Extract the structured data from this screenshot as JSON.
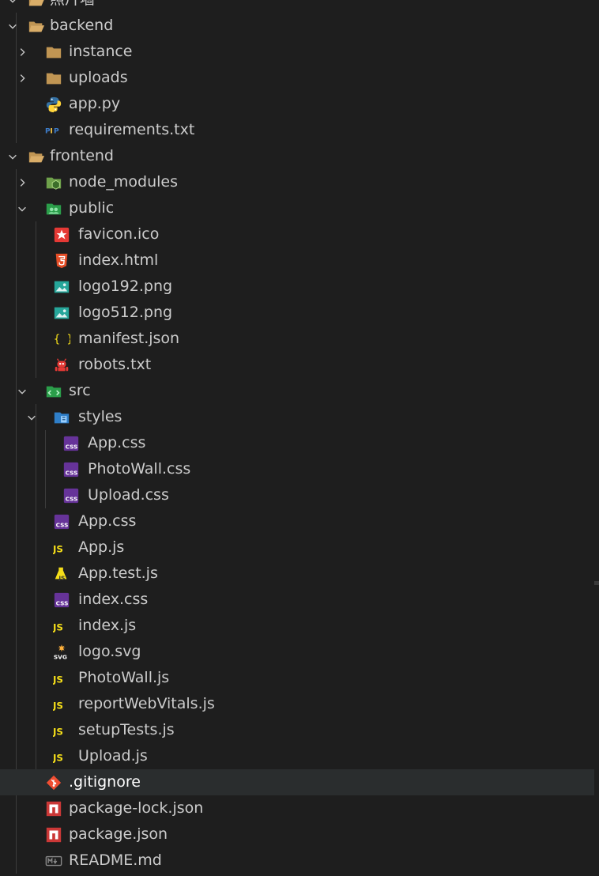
{
  "explorer": {
    "items": [
      {
        "label": "照片墙",
        "depth": 0,
        "kind": "folder",
        "expanded": true,
        "icon": "folder-open-icon"
      },
      {
        "label": "backend",
        "depth": 0,
        "kind": "folder",
        "expanded": true,
        "icon": "folder-open-icon"
      },
      {
        "label": "instance",
        "depth": 1,
        "kind": "folder",
        "expanded": false,
        "icon": "folder-icon"
      },
      {
        "label": "uploads",
        "depth": 1,
        "kind": "folder",
        "expanded": false,
        "icon": "folder-icon"
      },
      {
        "label": "app.py",
        "depth": 1,
        "kind": "file",
        "icon": "python-icon"
      },
      {
        "label": "requirements.txt",
        "depth": 1,
        "kind": "file",
        "icon": "pip-icon"
      },
      {
        "label": "frontend",
        "depth": 0,
        "kind": "folder",
        "expanded": true,
        "icon": "folder-open-icon"
      },
      {
        "label": "node_modules",
        "depth": 1,
        "kind": "folder",
        "expanded": false,
        "icon": "node-folder-icon"
      },
      {
        "label": "public",
        "depth": 1,
        "kind": "folder",
        "expanded": true,
        "icon": "public-folder-icon"
      },
      {
        "label": "favicon.ico",
        "depth": 2,
        "kind": "file",
        "icon": "favicon-icon"
      },
      {
        "label": "index.html",
        "depth": 2,
        "kind": "file",
        "icon": "html5-icon"
      },
      {
        "label": "logo192.png",
        "depth": 2,
        "kind": "file",
        "icon": "image-icon"
      },
      {
        "label": "logo512.png",
        "depth": 2,
        "kind": "file",
        "icon": "image-icon"
      },
      {
        "label": "manifest.json",
        "depth": 2,
        "kind": "file",
        "icon": "json-icon"
      },
      {
        "label": "robots.txt",
        "depth": 2,
        "kind": "file",
        "icon": "robot-icon"
      },
      {
        "label": "src",
        "depth": 1,
        "kind": "folder",
        "expanded": true,
        "icon": "src-folder-icon"
      },
      {
        "label": "styles",
        "depth": 2,
        "kind": "folder",
        "expanded": true,
        "icon": "styles-folder-icon"
      },
      {
        "label": "App.css",
        "depth": 3,
        "kind": "file",
        "icon": "css-icon"
      },
      {
        "label": "PhotoWall.css",
        "depth": 3,
        "kind": "file",
        "icon": "css-icon"
      },
      {
        "label": "Upload.css",
        "depth": 3,
        "kind": "file",
        "icon": "css-icon"
      },
      {
        "label": "App.css",
        "depth": 2,
        "kind": "file",
        "icon": "css-icon"
      },
      {
        "label": "App.js",
        "depth": 2,
        "kind": "file",
        "icon": "js-icon"
      },
      {
        "label": "App.test.js",
        "depth": 2,
        "kind": "file",
        "icon": "js-test-icon"
      },
      {
        "label": "index.css",
        "depth": 2,
        "kind": "file",
        "icon": "css-icon"
      },
      {
        "label": "index.js",
        "depth": 2,
        "kind": "file",
        "icon": "js-icon"
      },
      {
        "label": "logo.svg",
        "depth": 2,
        "kind": "file",
        "icon": "svg-icon"
      },
      {
        "label": "PhotoWall.js",
        "depth": 2,
        "kind": "file",
        "icon": "js-icon"
      },
      {
        "label": "reportWebVitals.js",
        "depth": 2,
        "kind": "file",
        "icon": "js-icon"
      },
      {
        "label": "setupTests.js",
        "depth": 2,
        "kind": "file",
        "icon": "js-icon"
      },
      {
        "label": "Upload.js",
        "depth": 2,
        "kind": "file",
        "icon": "js-icon"
      },
      {
        "label": ".gitignore",
        "depth": 1,
        "kind": "file",
        "icon": "git-icon",
        "selected": true
      },
      {
        "label": "package-lock.json",
        "depth": 1,
        "kind": "file",
        "icon": "npm-icon"
      },
      {
        "label": "package.json",
        "depth": 1,
        "kind": "file",
        "icon": "npm-icon"
      },
      {
        "label": "README.md",
        "depth": 1,
        "kind": "file",
        "icon": "markdown-icon"
      }
    ]
  },
  "colors": {
    "background": "#1e1e1e",
    "text": "#cccccc",
    "selection": "#2a2d2e",
    "folder": "#c09553",
    "js": "#f5de19",
    "css": "#663399",
    "html": "#e44d26",
    "image": "#26a69a",
    "npm": "#cb3837",
    "python_blue": "#3572a5",
    "python_yellow": "#ffd43b"
  }
}
